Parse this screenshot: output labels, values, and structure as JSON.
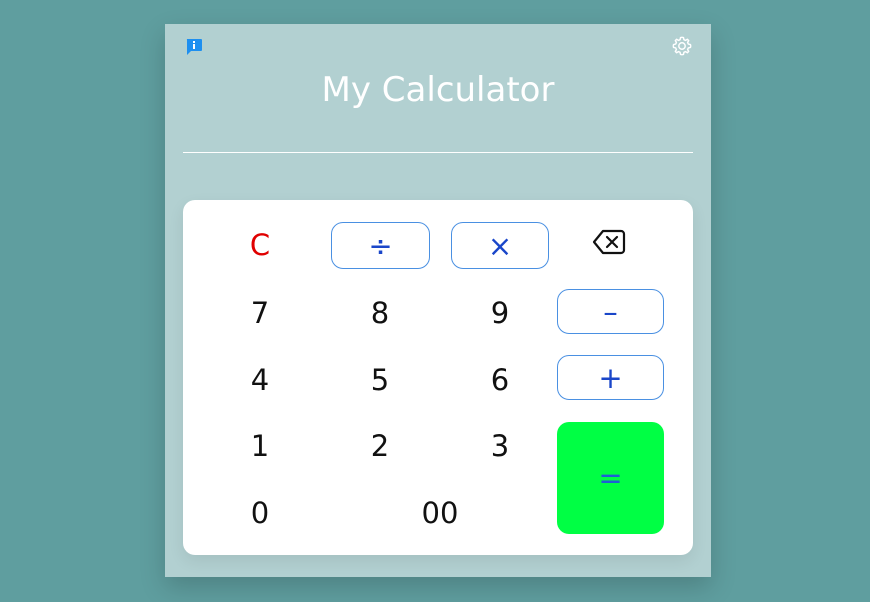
{
  "app": {
    "title": "My Calculator",
    "display_value": ""
  },
  "icons": {
    "info": "info-chat-icon",
    "settings": "gear-icon",
    "backspace": "backspace-icon"
  },
  "keys": {
    "clear": "C",
    "divide": "÷",
    "multiply": "×",
    "subtract": "–",
    "add": "+",
    "equals": "=",
    "seven": "7",
    "eight": "8",
    "nine": "9",
    "four": "4",
    "five": "5",
    "six": "6",
    "one": "1",
    "two": "2",
    "three": "3",
    "zero": "0",
    "double_zero": "00"
  },
  "colors": {
    "background": "#5f9e9f",
    "panel": "#b2d0d1",
    "keypad": "#ffffff",
    "clear_key": "#e00000",
    "operator_text": "#1a46c9",
    "operator_border": "#4a90e2",
    "equals_key": "#00ff44"
  }
}
